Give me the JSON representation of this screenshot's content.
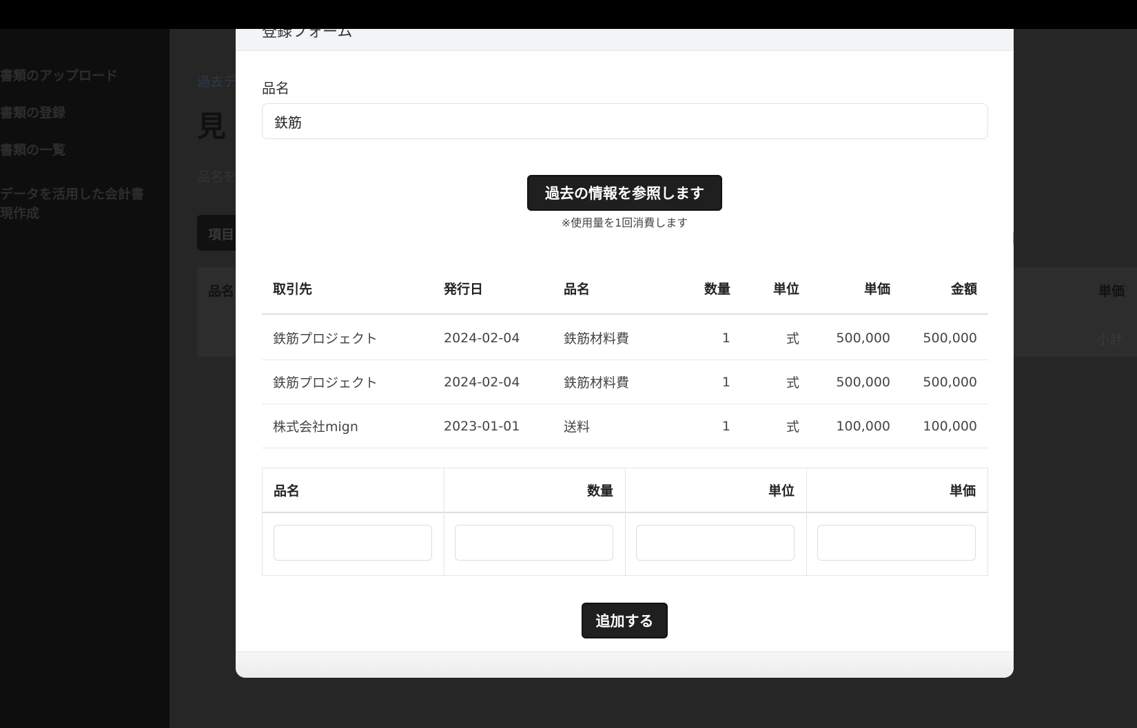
{
  "sidebar": {
    "items": [
      {
        "label": "書類のアップロード"
      },
      {
        "label": "書類の登録"
      },
      {
        "label": "書類の一覧"
      },
      {
        "label": "データを活用した会計書\n現作成"
      }
    ]
  },
  "background": {
    "breadcrumb": "過去デ",
    "title": "見",
    "subtitle": "品名を",
    "button": "項目",
    "table_col_first": "品名",
    "table_col_price": "単価",
    "subtotal": "小計"
  },
  "modal": {
    "header_title": "登録フォーム",
    "item_name_label": "品名",
    "item_name_value": "鉄筋",
    "reference_button": "過去の情報を参照します",
    "reference_note": "※使用量を1回消費します",
    "history_table": {
      "headers": [
        "取引先",
        "発行日",
        "品名",
        "数量",
        "単位",
        "単価",
        "金額"
      ],
      "rows": [
        [
          "鉄筋プロジェクト",
          "2024-02-04",
          "鉄筋材料費",
          "1",
          "式",
          "500,000",
          "500,000"
        ],
        [
          "鉄筋プロジェクト",
          "2024-02-04",
          "鉄筋材料費",
          "1",
          "式",
          "500,000",
          "500,000"
        ],
        [
          "株式会社mign",
          "2023-01-01",
          "送料",
          "1",
          "式",
          "100,000",
          "100,000"
        ]
      ]
    },
    "new_item_table": {
      "headers": [
        "品名",
        "数量",
        "単位",
        "単価"
      ],
      "values": [
        "",
        "",
        "",
        ""
      ]
    },
    "add_button": "追加する"
  },
  "icons": {
    "cursor": "mouse-pointer-icon"
  }
}
